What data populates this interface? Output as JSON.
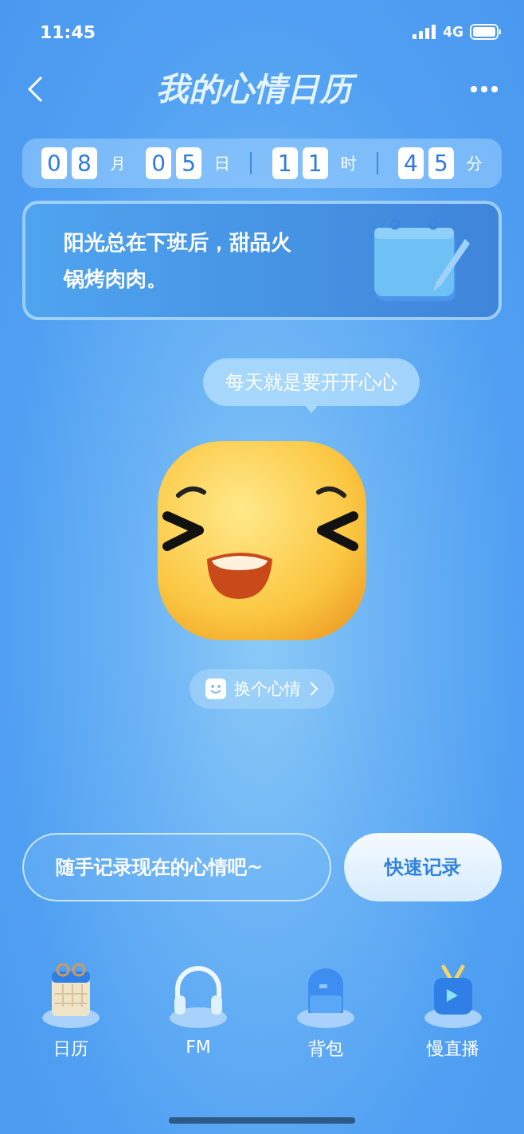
{
  "status_bar": {
    "time": "11:45",
    "network": "4G"
  },
  "header": {
    "title": "我的心情日历"
  },
  "datetime": {
    "groups": [
      {
        "digits": [
          "0",
          "8"
        ],
        "unit": "月"
      },
      {
        "digits": [
          "0",
          "5"
        ],
        "unit": "日"
      },
      {
        "digits": [
          "1",
          "1"
        ],
        "unit": "时"
      },
      {
        "digits": [
          "4",
          "5"
        ],
        "unit": "分"
      }
    ]
  },
  "note": {
    "text": "阳光总在下班后，甜品火锅烤肉肉。"
  },
  "mood": {
    "bubble": "每天就是要开开心心",
    "change_button": "换个心情"
  },
  "record": {
    "placeholder": "随手记录现在的心情吧~",
    "quick_button": "快速记录"
  },
  "dock": [
    {
      "kind": "calendar",
      "label": "日历"
    },
    {
      "kind": "headphones",
      "label": "FM"
    },
    {
      "kind": "backpack",
      "label": "背包"
    },
    {
      "kind": "tv",
      "label": "慢直播"
    }
  ]
}
